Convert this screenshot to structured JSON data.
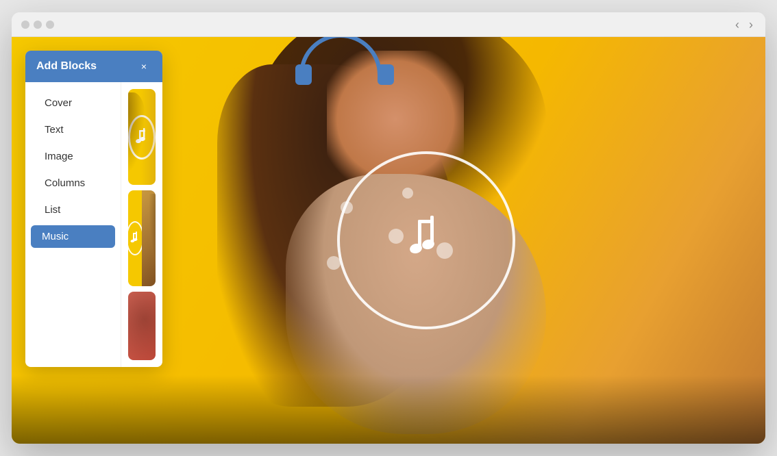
{
  "browser": {
    "nav_back": "‹",
    "nav_forward": "›"
  },
  "panel": {
    "title": "Add Blocks",
    "close_label": "×",
    "nav_items": [
      {
        "id": "cover",
        "label": "Cover",
        "active": false
      },
      {
        "id": "text",
        "label": "Text",
        "active": false
      },
      {
        "id": "image",
        "label": "Image",
        "active": false
      },
      {
        "id": "columns",
        "label": "Columns",
        "active": false
      },
      {
        "id": "list",
        "label": "List",
        "active": false
      },
      {
        "id": "music",
        "label": "Music",
        "active": true
      }
    ]
  },
  "thumbnails": [
    {
      "id": "thumb-1",
      "type": "full",
      "bg": "#f5c800"
    },
    {
      "id": "thumb-2",
      "type": "split",
      "bg_left": "#f5c800",
      "bg_right": "#c8984a"
    },
    {
      "id": "thumb-3",
      "type": "full",
      "bg": "#e06858"
    }
  ],
  "colors": {
    "panel_header_bg": "#4a7fc1",
    "panel_active_item_bg": "#4a7fc1",
    "thumb_yellow": "#f5c800",
    "thumb_orange_red": "#e06858",
    "main_bg_yellow": "#f5c800"
  }
}
